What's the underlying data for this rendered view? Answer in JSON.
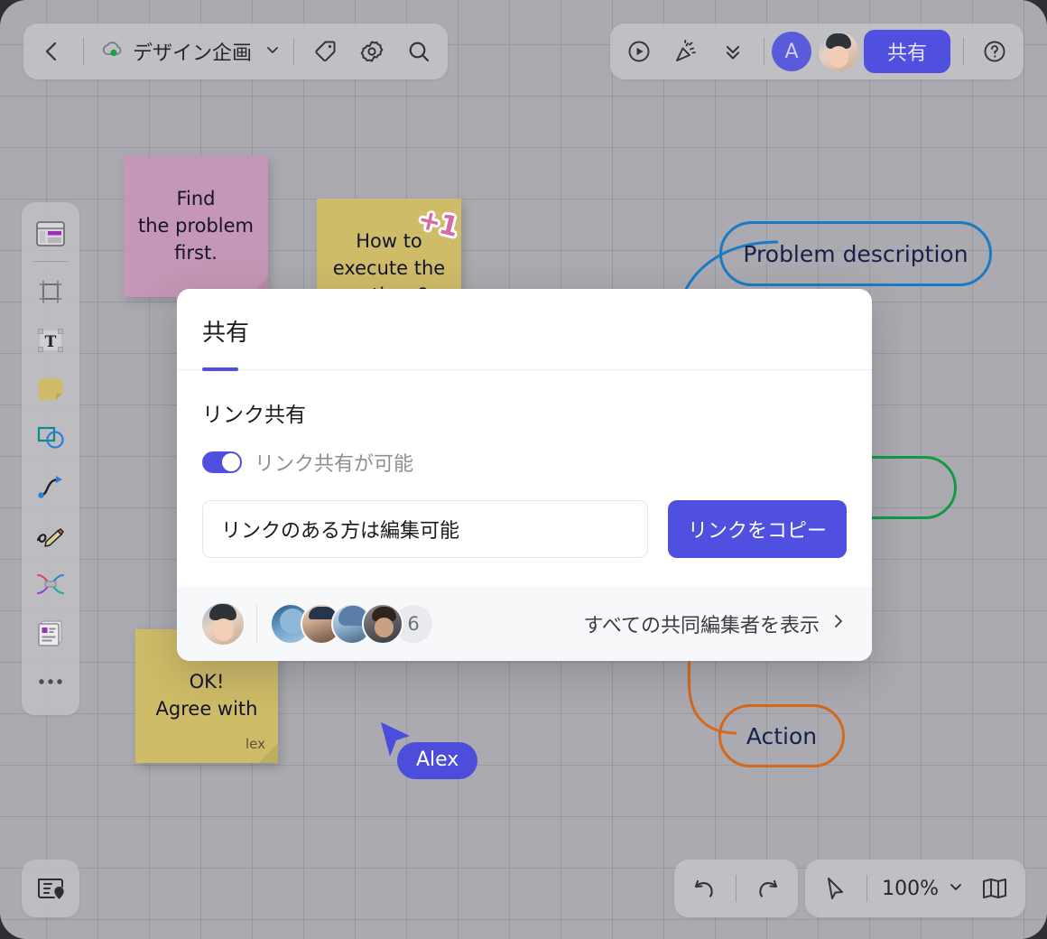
{
  "topbar": {
    "back_icon": "chevron-left-icon",
    "cloud_icon": "cloud-synced-icon",
    "board_name": "デザイン企画",
    "board_caret": "chevron-down-icon",
    "tag_icon": "tag-icon",
    "settings_icon": "gear-icon",
    "search_icon": "search-icon",
    "present_icon": "play-circle-icon",
    "celebrate_icon": "party-popper-icon",
    "collapse_icon": "double-chevron-down-icon",
    "avatar_initial": "A",
    "share_label": "共有",
    "help_icon": "question-circle-icon"
  },
  "rail": {
    "items": [
      {
        "name": "template-icon",
        "label": "テンプレート"
      },
      {
        "name": "frame-icon",
        "label": "フレーム"
      },
      {
        "name": "text-icon",
        "label": "テキスト"
      },
      {
        "name": "sticky-note-icon",
        "label": "付箋"
      },
      {
        "name": "shapes-icon",
        "label": "図形"
      },
      {
        "name": "connector-icon",
        "label": "コネクター"
      },
      {
        "name": "pen-icon",
        "label": "ペン"
      },
      {
        "name": "mindmap-icon",
        "label": "マインドマップ"
      },
      {
        "name": "card-icon",
        "label": "カード"
      },
      {
        "name": "more-icon",
        "label": "その他"
      }
    ]
  },
  "bottombar": {
    "frames_icon": "frames-panel-icon",
    "undo_icon": "undo-icon",
    "redo_icon": "redo-icon",
    "cursor_icon": "cursor-arrow-icon",
    "zoom_value": "100%",
    "zoom_caret": "chevron-down-icon",
    "minimap_icon": "map-icon"
  },
  "canvas": {
    "notes": [
      {
        "id": "note-find",
        "lines": [
          "Find",
          "the problem",
          "first."
        ],
        "color": "#c596b5"
      },
      {
        "id": "note-how",
        "lines": [
          "How to",
          "execute the",
          "actions?"
        ],
        "color": "#cfbc68",
        "sticker": "+1"
      },
      {
        "id": "note-ok",
        "lines": [
          "OK!",
          "Agree with"
        ],
        "color": "#cfbc68",
        "author": "lex"
      }
    ],
    "shapes": [
      {
        "id": "shape-problem",
        "label": "Problem description",
        "color": "#1b7ac4"
      },
      {
        "id": "shape-hidden-green",
        "label": "",
        "color": "#119a47"
      },
      {
        "id": "shape-action",
        "label": "Action",
        "color": "#d2691b"
      }
    ],
    "cursor": {
      "label": "Alex",
      "color": "#4c4ddb"
    }
  },
  "modal": {
    "title": "共有",
    "section_title": "リンク共有",
    "toggle_label": "リンク共有が可能",
    "toggle_on": true,
    "link_value": "リンクのある方は編集可能",
    "link_placeholder": "リンクのある方は編集可能",
    "copy_label": "リンクをコピー",
    "collaborator_count": "6",
    "view_all_label": "すべての共同編集者を表示",
    "view_all_caret": "chevron-right-icon"
  },
  "colors": {
    "accent": "#4f4fe0",
    "canvas": "#aaaab0",
    "modal_bg": "#ffffff",
    "footer_bg": "#f7f8fa"
  }
}
